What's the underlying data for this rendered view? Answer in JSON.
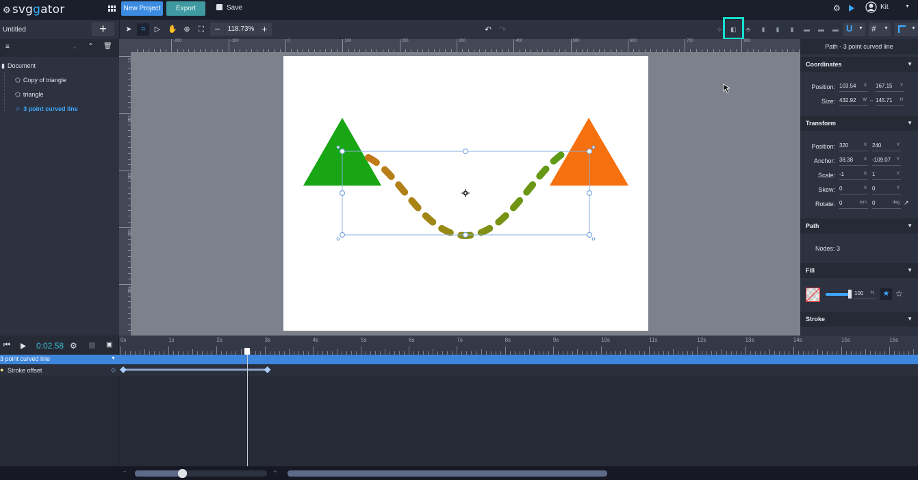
{
  "app": {
    "logo_prefix": "svg",
    "logo_highlight": "g",
    "logo_suffix": "ator"
  },
  "topbar": {
    "new_project": "New Project",
    "export": "Export",
    "save": "Save",
    "user_name": "Kit",
    "icons": [
      "apps-grid-icon",
      "settings-gear-icon",
      "play-preview-icon",
      "user-avatar-icon",
      "chevron-down-icon"
    ]
  },
  "toolbar": {
    "project_title": "Untitled",
    "add_label": "+",
    "zoom_minus": "−",
    "zoom_value": "118.73%",
    "zoom_plus": "+",
    "undo": "↶",
    "redo": "↷"
  },
  "layers": {
    "items": [
      {
        "label": "Document",
        "type": "document"
      },
      {
        "label": "Copy of triangle",
        "type": "polygon"
      },
      {
        "label": "triangle",
        "type": "polygon"
      },
      {
        "label": "3 point curved line",
        "type": "path",
        "selected": true
      }
    ]
  },
  "rulers": {
    "top": [
      "-200",
      "-100",
      "0",
      "100",
      "200",
      "300",
      "400",
      "500",
      "600",
      "700",
      "800"
    ],
    "left": [
      "0",
      "100",
      "200",
      "300",
      "400"
    ]
  },
  "canvas": {
    "left_triangle_color": "#19a614",
    "right_triangle_color": "#f5700f",
    "path_color_start": "#c47a18",
    "path_color_end": "#5a9c16",
    "selection_color": "#7aa7e0"
  },
  "inspector": {
    "title": "Path - 3 point curved line",
    "coordinates": {
      "label": "Coordinates",
      "position_label": "Position:",
      "position_x": "103.54",
      "position_x_unit": "X",
      "position_y": "167.15",
      "position_y_unit": "Y",
      "size_label": "Size:",
      "size_w": "432.92",
      "size_w_unit": "W",
      "size_h": "145.71",
      "size_h_unit": "H"
    },
    "transform": {
      "label": "Transform",
      "position_label": "Position:",
      "position_x": "320",
      "position_y": "240",
      "anchor_label": "Anchor:",
      "anchor_x": "38.38",
      "anchor_y": "-109.07",
      "scale_label": "Scale:",
      "scale_x": "-1",
      "scale_y": "1",
      "skew_label": "Skew:",
      "skew_x": "0",
      "skew_y": "0",
      "rotate_label": "Rotate:",
      "rotate_turn": "0",
      "rotate_turn_unit": "turn",
      "rotate_deg": "0",
      "rotate_deg_unit": "deg",
      "x_unit": "X",
      "y_unit": "Y"
    },
    "path": {
      "label": "Path",
      "nodes": "Nodes: 3"
    },
    "fill": {
      "label": "Fill",
      "opacity": "100",
      "opacity_unit": "%",
      "opacity_fraction": 1.0
    },
    "stroke": {
      "label": "Stroke"
    }
  },
  "timeline": {
    "time": "0:02.58",
    "seconds": [
      "0s",
      "1s",
      "2s",
      "3s",
      "4s",
      "5s",
      "6s",
      "7s",
      "8s",
      "9s",
      "10s",
      "11s",
      "12s",
      "13s",
      "14s",
      "15s",
      "16s"
    ],
    "playhead_seconds": 2.58,
    "layer_row": "3 point curved line",
    "property_row": "Stroke offset",
    "keyframes_seconds": [
      0,
      3
    ],
    "zoom_slider_fraction": 0.36
  }
}
